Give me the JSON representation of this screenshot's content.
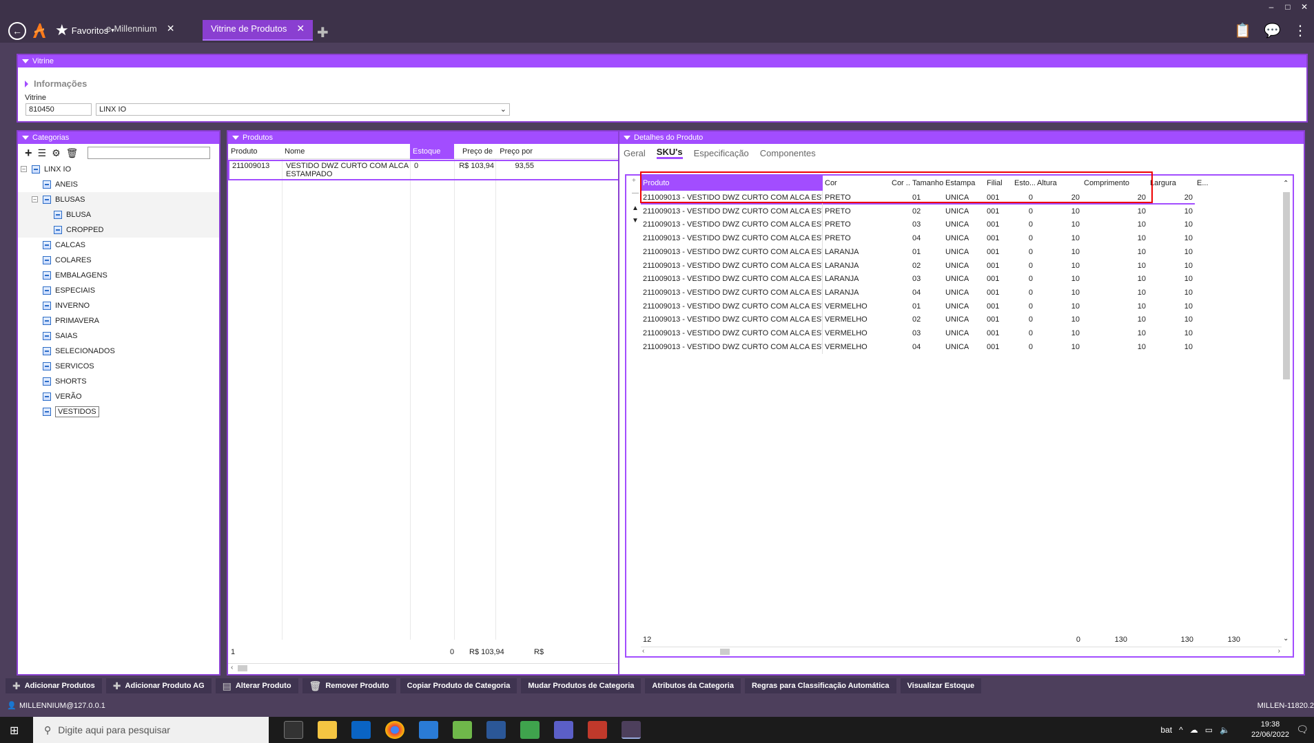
{
  "window": {
    "minimize": "–",
    "maximize": "□",
    "close": "✕"
  },
  "topbar": {
    "favorites_label": "Favoritos",
    "tabs": [
      {
        "label": "e-Millennium",
        "active": false
      },
      {
        "label": "Vitrine de Produtos",
        "active": true
      }
    ]
  },
  "vitrine": {
    "header": "Vitrine",
    "info_label": "Informações",
    "field_label": "Vitrine",
    "code_value": "810450",
    "select_value": "LINX IO"
  },
  "categorias": {
    "header": "Categorias",
    "search_value": "",
    "tree": [
      {
        "label": "LINX IO",
        "level": 0,
        "expander": "–"
      },
      {
        "label": "ANEIS",
        "level": 1
      },
      {
        "label": "BLUSAS",
        "level": 1,
        "expander": "–"
      },
      {
        "label": "BLUSA",
        "level": 2
      },
      {
        "label": "CROPPED",
        "level": 2
      },
      {
        "label": "CALCAS",
        "level": 1
      },
      {
        "label": "COLARES",
        "level": 1
      },
      {
        "label": "EMBALAGENS",
        "level": 1
      },
      {
        "label": "ESPECIAIS",
        "level": 1
      },
      {
        "label": "INVERNO",
        "level": 1
      },
      {
        "label": "PRIMAVERA",
        "level": 1
      },
      {
        "label": "SAIAS",
        "level": 1
      },
      {
        "label": "SELECIONADOS",
        "level": 1
      },
      {
        "label": "SERVICOS",
        "level": 1
      },
      {
        "label": "SHORTS",
        "level": 1
      },
      {
        "label": "VERÃO",
        "level": 1
      },
      {
        "label": "VESTIDOS",
        "level": 1,
        "selected": true
      }
    ]
  },
  "produtos": {
    "header": "Produtos",
    "columns": [
      "Produto",
      "Nome",
      "Estoque min",
      "Preço de",
      "Preço por"
    ],
    "rows": [
      {
        "produto": "211009013",
        "nome": "VESTIDO DWZ CURTO COM ALCA ESTAMPADO",
        "estoque_min": "0",
        "preco_de": "R$ 103,94",
        "preco_por": "93,55"
      }
    ],
    "footer": {
      "count": "1",
      "estoque": "0",
      "preco_de": "R$ 103,94",
      "preco_por": "R$"
    }
  },
  "detalhes": {
    "header": "Detalhes do Produto",
    "tabs": [
      "Geral",
      "SKU's",
      "Especificação",
      "Componentes"
    ],
    "active_tab": "SKU's",
    "columns": [
      "Produto",
      "Cor",
      "Cor ...",
      "Tamanho",
      "Estampa",
      "Filial",
      "Esto...",
      "Altura",
      "Comprimento",
      "Largura",
      "E..."
    ],
    "rows": [
      [
        "211009013 - VESTIDO DWZ CURTO COM ALCA ESTAMPADO",
        "PRETO",
        "",
        "01",
        "UNICA",
        "001",
        "0",
        "20",
        "20",
        "20"
      ],
      [
        "211009013 - VESTIDO DWZ CURTO COM ALCA ESTAMPADO",
        "PRETO",
        "",
        "02",
        "UNICA",
        "001",
        "0",
        "10",
        "10",
        "10"
      ],
      [
        "211009013 - VESTIDO DWZ CURTO COM ALCA ESTAMPADO",
        "PRETO",
        "",
        "03",
        "UNICA",
        "001",
        "0",
        "10",
        "10",
        "10"
      ],
      [
        "211009013 - VESTIDO DWZ CURTO COM ALCA ESTAMPADO",
        "PRETO",
        "",
        "04",
        "UNICA",
        "001",
        "0",
        "10",
        "10",
        "10"
      ],
      [
        "211009013 - VESTIDO DWZ CURTO COM ALCA ESTAMPADO",
        "LARANJA",
        "",
        "01",
        "UNICA",
        "001",
        "0",
        "10",
        "10",
        "10"
      ],
      [
        "211009013 - VESTIDO DWZ CURTO COM ALCA ESTAMPADO",
        "LARANJA",
        "",
        "02",
        "UNICA",
        "001",
        "0",
        "10",
        "10",
        "10"
      ],
      [
        "211009013 - VESTIDO DWZ CURTO COM ALCA ESTAMPADO",
        "LARANJA",
        "",
        "03",
        "UNICA",
        "001",
        "0",
        "10",
        "10",
        "10"
      ],
      [
        "211009013 - VESTIDO DWZ CURTO COM ALCA ESTAMPADO",
        "LARANJA",
        "",
        "04",
        "UNICA",
        "001",
        "0",
        "10",
        "10",
        "10"
      ],
      [
        "211009013 - VESTIDO DWZ CURTO COM ALCA ESTAMPADO",
        "VERMELHO",
        "",
        "01",
        "UNICA",
        "001",
        "0",
        "10",
        "10",
        "10"
      ],
      [
        "211009013 - VESTIDO DWZ CURTO COM ALCA ESTAMPADO",
        "VERMELHO",
        "",
        "02",
        "UNICA",
        "001",
        "0",
        "10",
        "10",
        "10"
      ],
      [
        "211009013 - VESTIDO DWZ CURTO COM ALCA ESTAMPADO",
        "VERMELHO",
        "",
        "03",
        "UNICA",
        "001",
        "0",
        "10",
        "10",
        "10"
      ],
      [
        "211009013 - VESTIDO DWZ CURTO COM ALCA ESTAMPADO",
        "VERMELHO",
        "",
        "04",
        "UNICA",
        "001",
        "0",
        "10",
        "10",
        "10"
      ]
    ],
    "footer": {
      "count": "12",
      "estoque": "0",
      "altura": "130",
      "comprimento": "130",
      "largura": "130"
    }
  },
  "bottom_buttons": [
    "Adicionar Produtos",
    "Adicionar Produto AG",
    "Alterar Produto",
    "Remover Produto",
    "Copiar Produto de Categoria",
    "Mudar Produtos de Categoria",
    "Atributos da Categoria",
    "Regras para Classificação Automática",
    "Visualizar Estoque"
  ],
  "status": {
    "user": "MILLENNIUM@127.0.0.1",
    "version": "MILLEN-11820.2"
  },
  "taskbar": {
    "search_placeholder": "Digite aqui para pesquisar",
    "tray_label": "bat",
    "time": "19:38",
    "date": "22/06/2022"
  },
  "colors": {
    "accent": "#a24dff",
    "topbar": "#3d3249",
    "background": "#4d3f5c",
    "highlight": "#e00000"
  }
}
